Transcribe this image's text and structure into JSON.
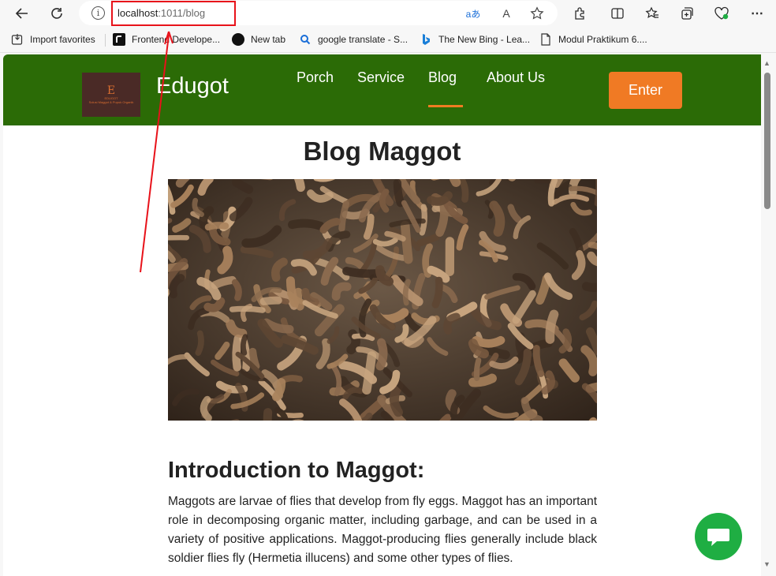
{
  "browser": {
    "url_host": "localhost",
    "url_path": ":1011/blog",
    "info_glyph": "i",
    "translate_glyph": "aあ",
    "read_aloud_glyph": "A",
    "favorites": [
      {
        "label": "Import favorites",
        "icon": "import-icon"
      },
      {
        "label": "Frontend Develope...",
        "icon": "frontend-icon"
      },
      {
        "label": "New tab",
        "icon": "circle-icon"
      },
      {
        "label": "google translate - S...",
        "icon": "search-icon"
      },
      {
        "label": "The New Bing - Lea...",
        "icon": "bing-icon"
      },
      {
        "label": "Modul Praktikum 6....",
        "icon": "document-icon"
      }
    ],
    "highlight_color": "#e8121a"
  },
  "site": {
    "brand": "Edugot",
    "logo_mark": "E",
    "logo_text": "EDUGOT",
    "logo_tagline": "Solusi Maggot & Pupuk Organik",
    "nav": [
      {
        "label": "Porch"
      },
      {
        "label": "Service"
      },
      {
        "label": "Blog"
      },
      {
        "label": "About Us"
      }
    ],
    "active_nav": "Blog",
    "enter_label": "Enter",
    "header_color": "#2b6b06",
    "accent_color": "#f07a24"
  },
  "content": {
    "title": "Blog Maggot",
    "section_title": "Introduction to Maggot:",
    "paragraph": "Maggots are larvae of flies that develop from fly eggs. Maggot has an important role in decomposing organic matter, including garbage, and can be used in a variety of positive applications. Maggot-producing flies generally include black soldier flies fly (Hermetia illucens) and some other types of flies."
  },
  "chat": {
    "icon": "chat-bubble-icon",
    "color": "#1fae43"
  }
}
